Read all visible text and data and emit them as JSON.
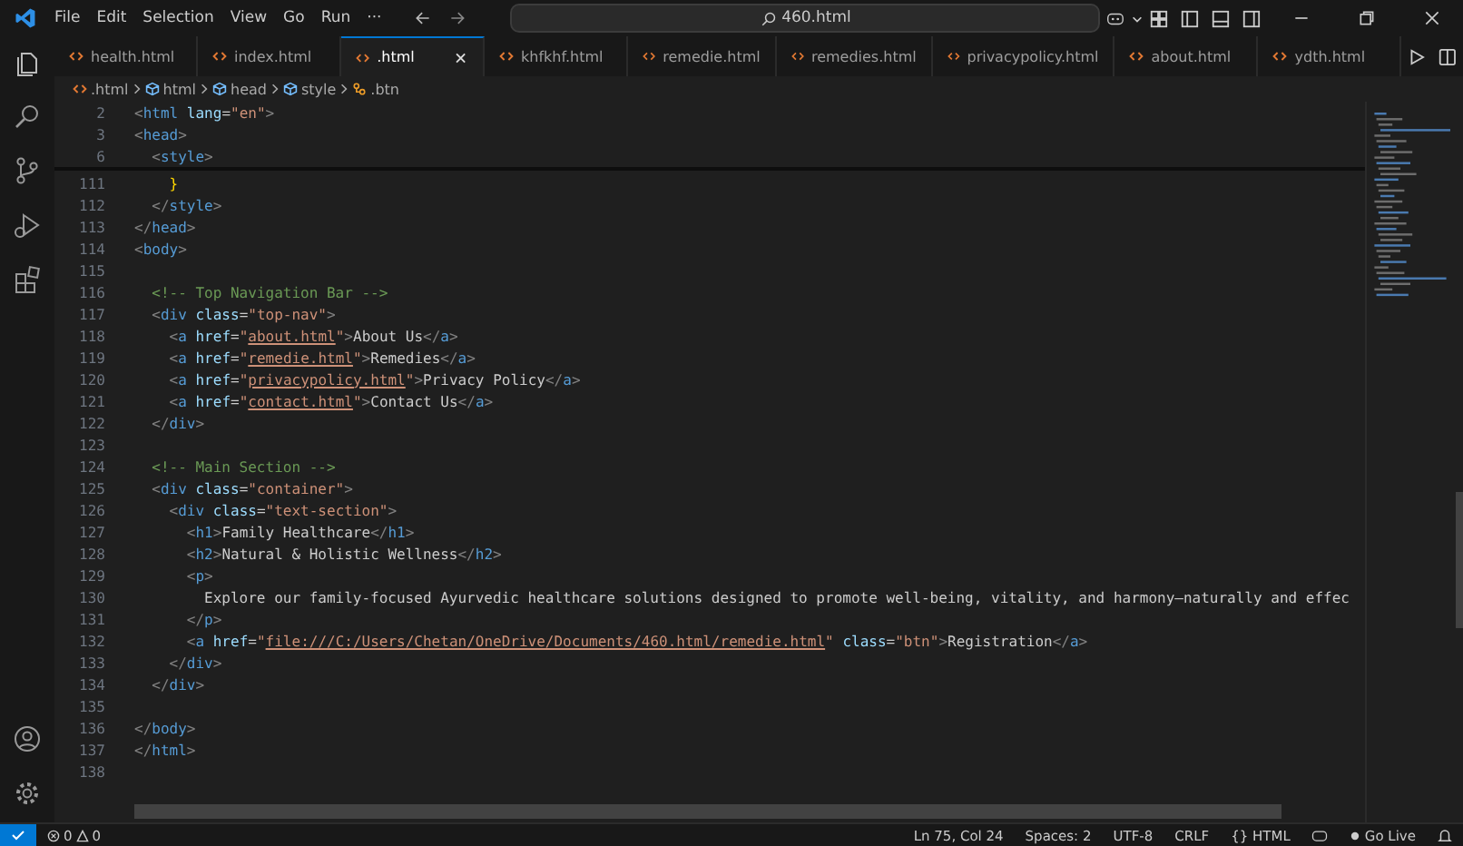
{
  "title_bar": {
    "menu": [
      "File",
      "Edit",
      "Selection",
      "View",
      "Go",
      "Run",
      "···"
    ],
    "search": "460.html"
  },
  "tabs": [
    {
      "label": "health.html",
      "selected": false
    },
    {
      "label": "index.html",
      "selected": false
    },
    {
      "label": ".html",
      "selected": true
    },
    {
      "label": "khfkhf.html",
      "selected": false
    },
    {
      "label": "remedie.html",
      "selected": false
    },
    {
      "label": "remedies.html",
      "selected": false
    },
    {
      "label": "privacypolicy.html",
      "selected": false
    },
    {
      "label": "about.html",
      "selected": false
    },
    {
      "label": "ydth.html",
      "selected": false
    }
  ],
  "breadcrumbs": [
    {
      "label": ".html",
      "kind": "file"
    },
    {
      "label": "html",
      "kind": "element"
    },
    {
      "label": "head",
      "kind": "element"
    },
    {
      "label": "style",
      "kind": "element"
    },
    {
      "label": ".btn",
      "kind": "selector"
    }
  ],
  "editor": {
    "sticky_lines": [
      {
        "number": "2",
        "tokens": [
          {
            "kind": "punct",
            "text": "<"
          },
          {
            "kind": "tag",
            "text": "html"
          },
          {
            "kind": "attr",
            "text": " lang"
          },
          {
            "kind": "text",
            "text": "="
          },
          {
            "kind": "string",
            "text": "\"en\""
          },
          {
            "kind": "punct",
            "text": ">"
          }
        ]
      },
      {
        "number": "3",
        "tokens": [
          {
            "kind": "punct",
            "text": "<"
          },
          {
            "kind": "tag",
            "text": "head"
          },
          {
            "kind": "punct",
            "text": ">"
          }
        ]
      },
      {
        "number": "6",
        "tokens": [
          {
            "kind": "punct",
            "text": "  <"
          },
          {
            "kind": "tag",
            "text": "style"
          },
          {
            "kind": "punct",
            "text": ">"
          }
        ]
      }
    ],
    "lines": [
      {
        "number": "111",
        "tokens": [
          {
            "kind": "brace",
            "text": "    }"
          }
        ]
      },
      {
        "number": "112",
        "tokens": [
          {
            "kind": "punct",
            "text": "  </"
          },
          {
            "kind": "tag",
            "text": "style"
          },
          {
            "kind": "punct",
            "text": ">"
          }
        ]
      },
      {
        "number": "113",
        "tokens": [
          {
            "kind": "punct",
            "text": "</"
          },
          {
            "kind": "tag",
            "text": "head"
          },
          {
            "kind": "punct",
            "text": ">"
          }
        ]
      },
      {
        "number": "114",
        "tokens": [
          {
            "kind": "punct",
            "text": "<"
          },
          {
            "kind": "tag",
            "text": "body"
          },
          {
            "kind": "punct",
            "text": ">"
          }
        ]
      },
      {
        "number": "115"
      },
      {
        "number": "116",
        "tokens": [
          {
            "kind": "comment",
            "text": "  <!-- Top Navigation Bar -->"
          }
        ]
      },
      {
        "number": "117",
        "tokens": [
          {
            "kind": "punct",
            "text": "  <"
          },
          {
            "kind": "tag",
            "text": "div"
          },
          {
            "kind": "attr",
            "text": " class"
          },
          {
            "kind": "text",
            "text": "="
          },
          {
            "kind": "string",
            "text": "\"top-nav\""
          },
          {
            "kind": "punct",
            "text": ">"
          }
        ]
      },
      {
        "number": "118",
        "tokens": [
          {
            "kind": "punct",
            "text": "    <"
          },
          {
            "kind": "tag",
            "text": "a"
          },
          {
            "kind": "attr",
            "text": " href"
          },
          {
            "kind": "text",
            "text": "="
          },
          {
            "kind": "string",
            "text": "\""
          },
          {
            "kind": "link",
            "text": "about.html"
          },
          {
            "kind": "string",
            "text": "\""
          },
          {
            "kind": "punct",
            "text": ">"
          },
          {
            "kind": "text",
            "text": "About Us"
          },
          {
            "kind": "punct",
            "text": "</"
          },
          {
            "kind": "tag",
            "text": "a"
          },
          {
            "kind": "punct",
            "text": ">"
          }
        ]
      },
      {
        "number": "119",
        "tokens": [
          {
            "kind": "punct",
            "text": "    <"
          },
          {
            "kind": "tag",
            "text": "a"
          },
          {
            "kind": "attr",
            "text": " href"
          },
          {
            "kind": "text",
            "text": "="
          },
          {
            "kind": "string",
            "text": "\""
          },
          {
            "kind": "link",
            "text": "remedie.html"
          },
          {
            "kind": "string",
            "text": "\""
          },
          {
            "kind": "punct",
            "text": ">"
          },
          {
            "kind": "text",
            "text": "Remedies"
          },
          {
            "kind": "punct",
            "text": "</"
          },
          {
            "kind": "tag",
            "text": "a"
          },
          {
            "kind": "punct",
            "text": ">"
          }
        ]
      },
      {
        "number": "120",
        "tokens": [
          {
            "kind": "punct",
            "text": "    <"
          },
          {
            "kind": "tag",
            "text": "a"
          },
          {
            "kind": "attr",
            "text": " href"
          },
          {
            "kind": "text",
            "text": "="
          },
          {
            "kind": "string",
            "text": "\""
          },
          {
            "kind": "link",
            "text": "privacypolicy.html"
          },
          {
            "kind": "string",
            "text": "\""
          },
          {
            "kind": "punct",
            "text": ">"
          },
          {
            "kind": "text",
            "text": "Privacy Policy"
          },
          {
            "kind": "punct",
            "text": "</"
          },
          {
            "kind": "tag",
            "text": "a"
          },
          {
            "kind": "punct",
            "text": ">"
          }
        ]
      },
      {
        "number": "121",
        "tokens": [
          {
            "kind": "punct",
            "text": "    <"
          },
          {
            "kind": "tag",
            "text": "a"
          },
          {
            "kind": "attr",
            "text": " href"
          },
          {
            "kind": "text",
            "text": "="
          },
          {
            "kind": "string",
            "text": "\""
          },
          {
            "kind": "link",
            "text": "contact.html"
          },
          {
            "kind": "string",
            "text": "\""
          },
          {
            "kind": "punct",
            "text": ">"
          },
          {
            "kind": "text",
            "text": "Contact Us"
          },
          {
            "kind": "punct",
            "text": "</"
          },
          {
            "kind": "tag",
            "text": "a"
          },
          {
            "kind": "punct",
            "text": ">"
          }
        ]
      },
      {
        "number": "122",
        "tokens": [
          {
            "kind": "punct",
            "text": "  </"
          },
          {
            "kind": "tag",
            "text": "div"
          },
          {
            "kind": "punct",
            "text": ">"
          }
        ]
      },
      {
        "number": "123"
      },
      {
        "number": "124",
        "tokens": [
          {
            "kind": "comment",
            "text": "  <!-- Main Section -->"
          }
        ]
      },
      {
        "number": "125",
        "tokens": [
          {
            "kind": "punct",
            "text": "  <"
          },
          {
            "kind": "tag",
            "text": "div"
          },
          {
            "kind": "attr",
            "text": " class"
          },
          {
            "kind": "text",
            "text": "="
          },
          {
            "kind": "string",
            "text": "\"container\""
          },
          {
            "kind": "punct",
            "text": ">"
          }
        ]
      },
      {
        "number": "126",
        "tokens": [
          {
            "kind": "punct",
            "text": "    <"
          },
          {
            "kind": "tag",
            "text": "div"
          },
          {
            "kind": "attr",
            "text": " class"
          },
          {
            "kind": "text",
            "text": "="
          },
          {
            "kind": "string",
            "text": "\"text-section\""
          },
          {
            "kind": "punct",
            "text": ">"
          }
        ]
      },
      {
        "number": "127",
        "tokens": [
          {
            "kind": "punct",
            "text": "      <"
          },
          {
            "kind": "tag",
            "text": "h1"
          },
          {
            "kind": "punct",
            "text": ">"
          },
          {
            "kind": "text",
            "text": "Family Healthcare"
          },
          {
            "kind": "punct",
            "text": "</"
          },
          {
            "kind": "tag",
            "text": "h1"
          },
          {
            "kind": "punct",
            "text": ">"
          }
        ]
      },
      {
        "number": "128",
        "tokens": [
          {
            "kind": "punct",
            "text": "      <"
          },
          {
            "kind": "tag",
            "text": "h2"
          },
          {
            "kind": "punct",
            "text": ">"
          },
          {
            "kind": "text",
            "text": "Natural & Holistic Wellness"
          },
          {
            "kind": "punct",
            "text": "</"
          },
          {
            "kind": "tag",
            "text": "h2"
          },
          {
            "kind": "punct",
            "text": ">"
          }
        ]
      },
      {
        "number": "129",
        "tokens": [
          {
            "kind": "punct",
            "text": "      <"
          },
          {
            "kind": "tag",
            "text": "p"
          },
          {
            "kind": "punct",
            "text": ">"
          }
        ]
      },
      {
        "number": "130",
        "tokens": [
          {
            "kind": "text",
            "text": "        Explore our family-focused Ayurvedic healthcare solutions designed to promote well-being, vitality, and harmony—naturally and effec"
          }
        ]
      },
      {
        "number": "131",
        "tokens": [
          {
            "kind": "punct",
            "text": "      </"
          },
          {
            "kind": "tag",
            "text": "p"
          },
          {
            "kind": "punct",
            "text": ">"
          }
        ]
      },
      {
        "number": "132",
        "tokens": [
          {
            "kind": "punct",
            "text": "      <"
          },
          {
            "kind": "tag",
            "text": "a"
          },
          {
            "kind": "attr",
            "text": " href"
          },
          {
            "kind": "text",
            "text": "="
          },
          {
            "kind": "string",
            "text": "\""
          },
          {
            "kind": "link",
            "text": "file:///C:/Users/Chetan/OneDrive/Documents/460.html/remedie.html"
          },
          {
            "kind": "string",
            "text": "\""
          },
          {
            "kind": "attr",
            "text": " class"
          },
          {
            "kind": "text",
            "text": "="
          },
          {
            "kind": "string",
            "text": "\"btn\""
          },
          {
            "kind": "punct",
            "text": ">"
          },
          {
            "kind": "text",
            "text": "Registration"
          },
          {
            "kind": "punct",
            "text": "</"
          },
          {
            "kind": "tag",
            "text": "a"
          },
          {
            "kind": "punct",
            "text": ">"
          }
        ]
      },
      {
        "number": "133",
        "tokens": [
          {
            "kind": "punct",
            "text": "    </"
          },
          {
            "kind": "tag",
            "text": "div"
          },
          {
            "kind": "punct",
            "text": ">"
          }
        ]
      },
      {
        "number": "134",
        "tokens": [
          {
            "kind": "punct",
            "text": "  </"
          },
          {
            "kind": "tag",
            "text": "div"
          },
          {
            "kind": "punct",
            "text": ">"
          }
        ]
      },
      {
        "number": "135"
      },
      {
        "number": "136",
        "tokens": [
          {
            "kind": "punct",
            "text": "</"
          },
          {
            "kind": "tag",
            "text": "body"
          },
          {
            "kind": "punct",
            "text": ">"
          }
        ]
      },
      {
        "number": "137",
        "tokens": [
          {
            "kind": "punct",
            "text": "</"
          },
          {
            "kind": "tag",
            "text": "html"
          },
          {
            "kind": "punct",
            "text": ">"
          }
        ]
      },
      {
        "number": "138"
      }
    ]
  },
  "status_bar": {
    "errors": "0",
    "warnings": "0",
    "items": [
      "Ln 75, Col 24",
      "Spaces: 2",
      "UTF-8",
      "CRLF",
      "{} HTML"
    ],
    "go_live": "Go Live"
  }
}
